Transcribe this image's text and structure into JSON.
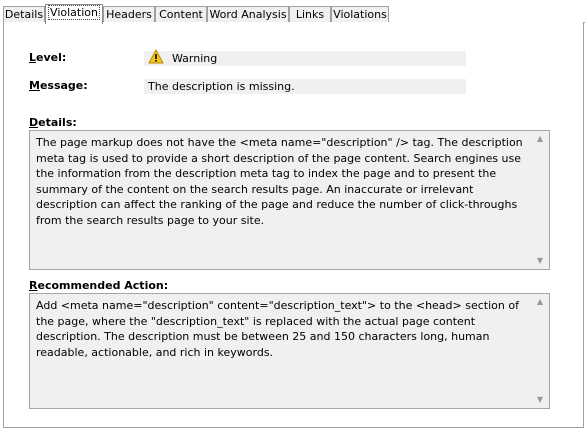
{
  "tabs": [
    "Details",
    "Violation",
    "Headers",
    "Content",
    "Word Analysis",
    "Links",
    "Violations"
  ],
  "active_tab": "Violation",
  "level": {
    "label": "Level:",
    "value": "Warning",
    "icon": "warning-triangle-icon"
  },
  "message": {
    "label": "Message:",
    "value": "The description is missing."
  },
  "details": {
    "label": "Details:",
    "text": "The page markup does not have the <meta name=\"description\" /> tag. The description meta tag is used to provide a short description of the page content. Search engines use the information from the description meta tag to index the page and to present the summary of the content on the search results page. An inaccurate or irrelevant description can affect the ranking of the page and reduce the number of click-throughs from the search results page to your site."
  },
  "recommended_action": {
    "label": "Recommended Action:",
    "text": "Add <meta name=\"description\" content=\"description_text\"> to the <head> section of the page, where the \"description_text\" is replaced with the actual page content description. The description must be between 25 and 150 characters long, human readable, actionable, and rich in keywords."
  },
  "colors": {
    "warning": "#f5c518",
    "field_bg": "#f0f0f0",
    "border": "#a0a0a0"
  }
}
